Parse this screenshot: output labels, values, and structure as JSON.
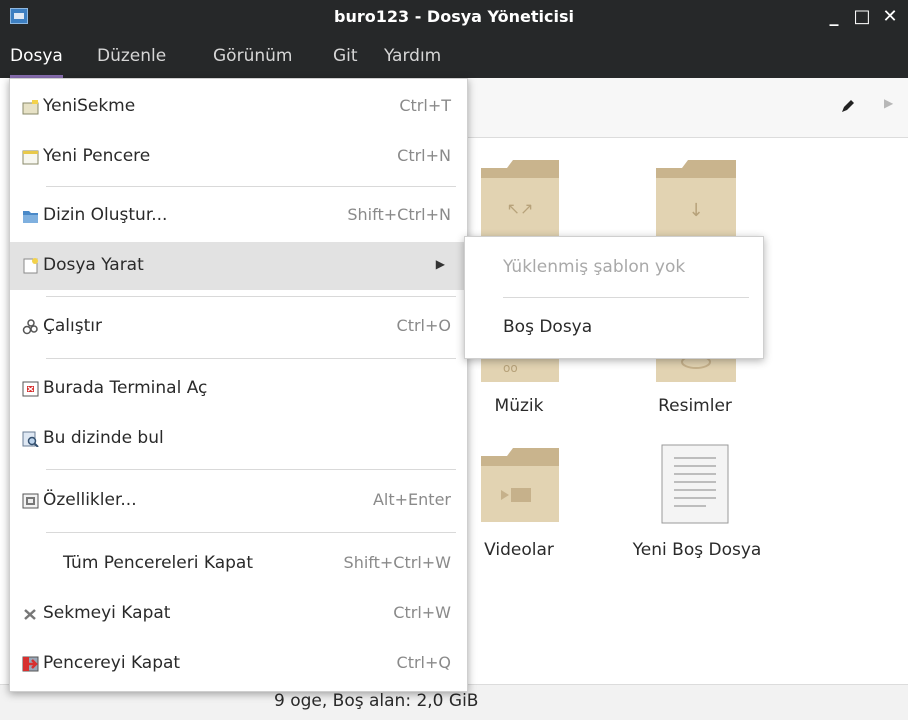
{
  "window": {
    "title": "buro123 - Dosya Yöneticisi",
    "minimize": "_",
    "maximize": "□",
    "close": "✕"
  },
  "menubar": [
    {
      "label": "Dosya",
      "active": true
    },
    {
      "label": "Düzenle"
    },
    {
      "label": "Görünüm"
    },
    {
      "label": "Git"
    },
    {
      "label": "Yardım"
    }
  ],
  "file_menu": {
    "items": [
      {
        "label": "YeniSekme",
        "accel": "Ctrl+T",
        "icon": "new-tab-icon"
      },
      {
        "label": "Yeni Pencere",
        "accel": "Ctrl+N",
        "icon": "new-window-icon"
      },
      {
        "label": "Dizin Oluştur...",
        "accel": "Shift+Ctrl+N",
        "icon": "folder-new-icon"
      },
      {
        "label": "Dosya Yarat",
        "accel": "▶",
        "icon": "file-new-icon"
      },
      {
        "label": "Çalıştır",
        "accel": "Ctrl+O",
        "icon": "run-icon"
      },
      {
        "label": "Burada Terminal Aç",
        "accel": "",
        "icon": "terminal-icon"
      },
      {
        "label": "Bu dizinde bul",
        "accel": "",
        "icon": "find-icon"
      },
      {
        "label": "Özellikler...",
        "accel": "Alt+Enter",
        "icon": "properties-icon"
      },
      {
        "label": "Tüm Pencereleri Kapat",
        "accel": "Shift+Ctrl+W",
        "icon": ""
      },
      {
        "label": "Sekmeyi Kapat",
        "accel": "Ctrl+W",
        "icon": "close-tab-icon"
      },
      {
        "label": "Pencereyi Kapat",
        "accel": "Ctrl+Q",
        "icon": "close-window-icon"
      }
    ]
  },
  "submenu": {
    "no_templates": "Yüklenmiş şablon yok",
    "empty_file": "Boş Dosya"
  },
  "content": {
    "items": [
      {
        "label": "Müzik",
        "icon": "music-folder-icon"
      },
      {
        "label": "Resimler",
        "icon": "pictures-folder-icon"
      },
      {
        "label": "Videolar",
        "icon": "videos-folder-icon"
      },
      {
        "label": "Yeni Boş Dosya",
        "icon": "text-file-icon"
      }
    ]
  },
  "status": {
    "text": "9 oge, Boş alan: 2,0 GiB"
  },
  "colors": {
    "titlebar": "#262829",
    "menu_highlight": "#e2e2e2",
    "active_menu_underline": "#8a6fb3",
    "folder": "#d8c8a6"
  }
}
